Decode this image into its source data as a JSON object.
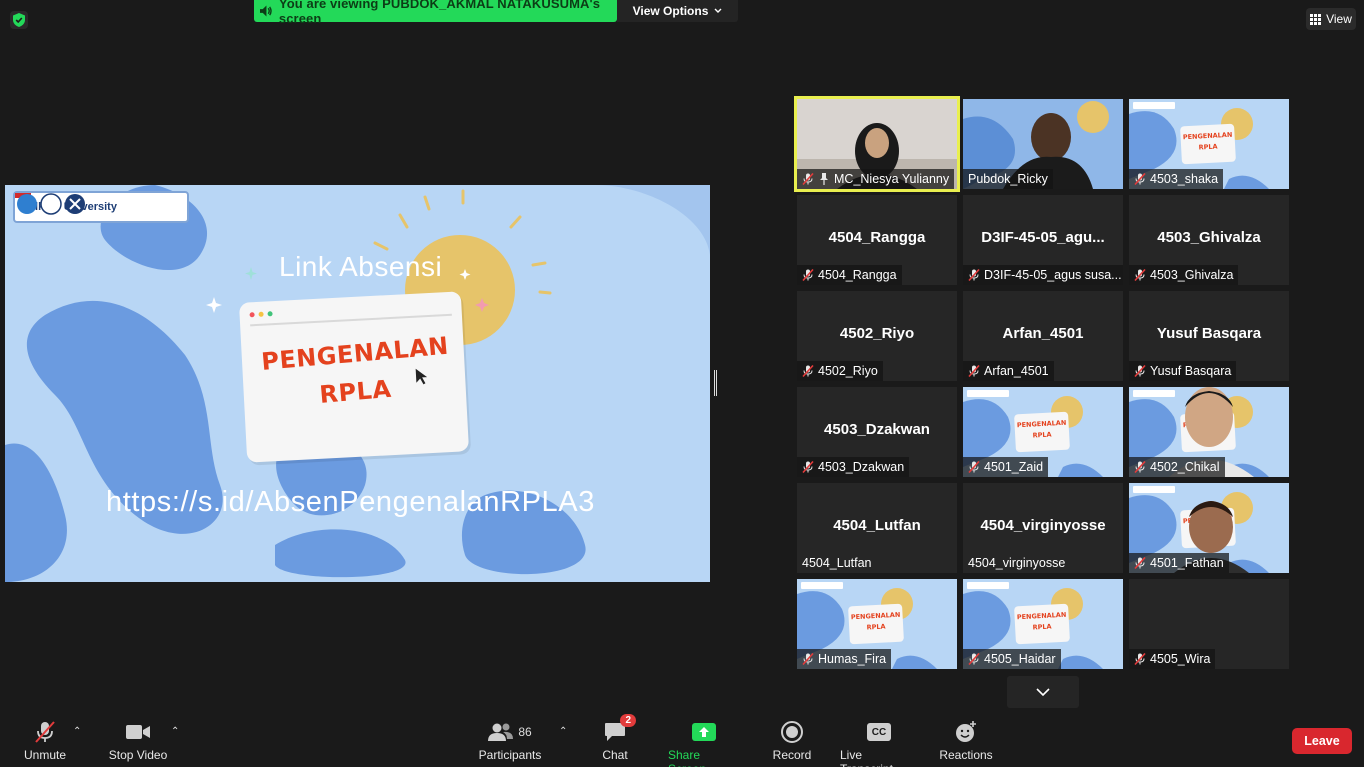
{
  "banner": {
    "text": "You are viewing PUBDOK_AKMAL NATAKUSUMA's screen",
    "view_options": "View Options"
  },
  "view_button": "View",
  "share": {
    "logo_text": "Telkom University",
    "link_title": "Link Absensi",
    "card_line1": "PENGENALAN",
    "card_line2": "RPLA",
    "url": "https://s.id/AbsenPengenalanRPLA3"
  },
  "tiles": [
    {
      "name": "MC_Niesya Yulianny",
      "big": "",
      "video": true,
      "muted": true,
      "pinned": true,
      "active": true
    },
    {
      "name": "Pubdok_Ricky",
      "big": "",
      "video": true,
      "muted": false
    },
    {
      "name": "4503_shaka",
      "big": "",
      "video": true,
      "muted": true
    },
    {
      "name": "4504_Rangga",
      "big": "4504_Rangga",
      "video": false,
      "muted": true
    },
    {
      "name": "D3IF-45-05_agus susa...",
      "big": "D3IF-45-05_agu...",
      "video": false,
      "muted": true
    },
    {
      "name": "4503_Ghivalza",
      "big": "4503_Ghivalza",
      "video": false,
      "muted": true
    },
    {
      "name": "4502_Riyo",
      "big": "4502_Riyo",
      "video": false,
      "muted": true
    },
    {
      "name": "Arfan_4501",
      "big": "Arfan_4501",
      "video": false,
      "muted": true
    },
    {
      "name": "Yusuf Basqara",
      "big": "Yusuf Basqara",
      "video": false,
      "muted": true
    },
    {
      "name": "4503_Dzakwan",
      "big": "4503_Dzakwan",
      "video": false,
      "muted": true
    },
    {
      "name": "4501_Zaid",
      "big": "",
      "video": true,
      "muted": true
    },
    {
      "name": "4502_Chikal",
      "big": "",
      "video": true,
      "muted": true
    },
    {
      "name": "4504_Lutfan",
      "big": "4504_Lutfan",
      "video": false,
      "muted": false
    },
    {
      "name": "4504_virginyosse",
      "big": "4504_virginyosse",
      "video": false,
      "muted": false
    },
    {
      "name": "4501_Fathan",
      "big": "",
      "video": true,
      "muted": true
    },
    {
      "name": "Humas_Fira",
      "big": "",
      "video": true,
      "muted": true
    },
    {
      "name": "4505_Haidar",
      "big": "",
      "video": true,
      "muted": true
    },
    {
      "name": "4505_Wira",
      "big": "",
      "video": false,
      "muted": true
    }
  ],
  "toolbar": {
    "unmute": "Unmute",
    "stop_video": "Stop Video",
    "participants": "Participants",
    "participants_count": "86",
    "chat": "Chat",
    "chat_badge": "2",
    "share_screen": "Share Screen",
    "record": "Record",
    "live_transcript": "Live Transcript",
    "cc": "CC",
    "reactions": "Reactions",
    "leave": "Leave"
  },
  "colors": {
    "banner_green": "#23d959",
    "leave_red": "#d9272e",
    "active_speaker": "#e9ef4f",
    "slide_bg": "#b8d6f5"
  }
}
